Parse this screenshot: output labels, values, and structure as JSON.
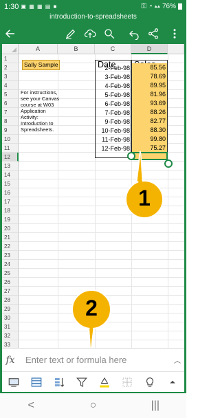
{
  "status": {
    "time": "1:30",
    "battery": "76%"
  },
  "app": {
    "filename": "introduction-to-spreadsheets",
    "accent": "#1e8a46"
  },
  "sheet": {
    "columns": [
      "A",
      "B",
      "C",
      "D"
    ],
    "selected_column": "D",
    "row_numbers": [
      "1",
      "2",
      "3",
      "4",
      "5",
      "6",
      "7",
      "8",
      "9",
      "10",
      "11",
      "12",
      "13",
      "14",
      "15",
      "16",
      "17",
      "18",
      "19",
      "20",
      "21",
      "22",
      "23",
      "24",
      "25",
      "26",
      "27",
      "28",
      "29",
      "30",
      "31",
      "32",
      "33",
      "34"
    ],
    "selected_row": "12",
    "name_cell": "Sally Sample",
    "instructions": "For instructions, see your Canvas course at W03 Application Activity: Introduction to Spreadsheets.",
    "date_header": "Date",
    "sales_header": "Sales",
    "rows": [
      {
        "date": "2-Feb-98",
        "sales": "85.56"
      },
      {
        "date": "3-Feb-98",
        "sales": "78.69"
      },
      {
        "date": "4-Feb-98",
        "sales": "89.95"
      },
      {
        "date": "5-Feb-98",
        "sales": "81.96"
      },
      {
        "date": "6-Feb-98",
        "sales": "93.69"
      },
      {
        "date": "7-Feb-98",
        "sales": "88.26"
      },
      {
        "date": "9-Feb-98",
        "sales": "82.77"
      },
      {
        "date": "10-Feb-98",
        "sales": "88.30"
      },
      {
        "date": "11-Feb-98",
        "sales": "99.80"
      },
      {
        "date": "12-Feb-98",
        "sales": "75.27"
      }
    ],
    "highlight_color": "#fcd36d"
  },
  "callouts": [
    {
      "number": "1"
    },
    {
      "number": "2"
    }
  ],
  "formula_bar": {
    "fx_label": "fx",
    "placeholder": "Enter text or formula here"
  },
  "toolbar_icons": [
    "view-icon",
    "table-icon",
    "sort-icon",
    "filter-icon",
    "fill-color-icon",
    "borders-icon",
    "lightbulb-icon",
    "expand-icon"
  ],
  "nav": {
    "back": "<",
    "home": "○",
    "recents": "|||"
  }
}
